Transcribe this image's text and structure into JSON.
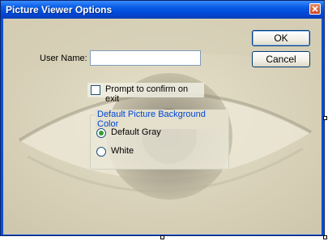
{
  "window": {
    "title": "Picture Viewer Options",
    "close_icon": "close-icon"
  },
  "form": {
    "user_name_label": "User Name:",
    "user_name_value": "",
    "prompt_checkbox_label": "Prompt to confirm on exit",
    "prompt_checked": false
  },
  "buttons": {
    "ok_label": "OK",
    "cancel_label": "Cancel"
  },
  "background_group": {
    "title": "Default Picture Background Color",
    "options": [
      {
        "label": "Default Gray",
        "selected": true
      },
      {
        "label": "White",
        "selected": false
      }
    ]
  },
  "colors": {
    "title_bar": "#0a5ee6",
    "group_title": "#0046d5",
    "radio_selected": "#2fa12f"
  }
}
